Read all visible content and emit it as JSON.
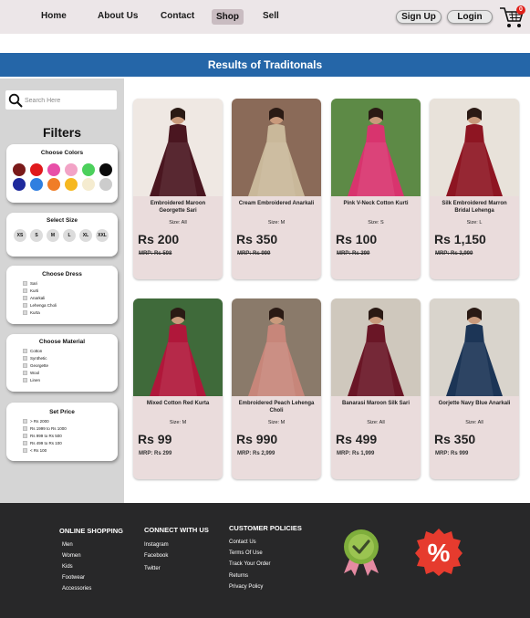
{
  "nav": {
    "home": "Home",
    "about": "About Us",
    "contact": "Contact",
    "shop": "Shop",
    "sell": "Sell",
    "signup": "Sign Up",
    "login": "Login",
    "cart_count": "0"
  },
  "results_title": "Results of Traditonals",
  "search": {
    "placeholder": "Search Here"
  },
  "filters": {
    "title": "Filters",
    "colors": {
      "title": "Choose Colors",
      "swatches": [
        "#7a1a1a",
        "#e0191c",
        "#e84fa8",
        "#f2a3c6",
        "#4cd05c",
        "#0b0b0b",
        "#1f2a9c",
        "#2f7fe0",
        "#f07d27",
        "#f6b820",
        "#f5ecd0",
        "#cccccc"
      ]
    },
    "size": {
      "title": "Select Size",
      "options": [
        "XS",
        "S",
        "M",
        "L",
        "XL",
        "XXL"
      ]
    },
    "dress": {
      "title": "Choose Dress",
      "options": [
        "Sari",
        "Kurti",
        "Anarkali",
        "Lehenga Choli",
        "Kurta"
      ]
    },
    "material": {
      "title": "Choose Material",
      "options": [
        "Cotton",
        "Synthetic",
        "Georgette",
        "Wool",
        "Linen"
      ]
    },
    "price": {
      "title": "Set Price",
      "options": [
        "> Rs 2000",
        "Rs 1999 to Rs 1000",
        "Rs 999 to Rs 500",
        "Rs 499 to Rs 100",
        "< Rs 100"
      ]
    }
  },
  "products": [
    {
      "name": "Embroidered Maroon Georgette Sari",
      "size": "Size: All",
      "price": "Rs 200",
      "mrp": "MRP: Rs 598",
      "mrp_strike": true,
      "garment_color": "#4a1620",
      "bg_color": "#efe8e3"
    },
    {
      "name": "Cream Embroidered Anarkali",
      "size": "Size: M",
      "price": "Rs 350",
      "mrp": "MRP: Rs 999",
      "mrp_strike": true,
      "garment_color": "#c9b89a",
      "bg_color": "#8a6a58"
    },
    {
      "name": "Pink V-Neck Cotton Kurti",
      "size": "Size: S",
      "price": "Rs 100",
      "mrp": "MRP: Rs 399",
      "mrp_strike": true,
      "garment_color": "#d8346e",
      "bg_color": "#5d8a46"
    },
    {
      "name": "Silk Embroidered Marron Bridal Lehenga",
      "size": "Size: L",
      "price": "Rs 1,150",
      "mrp": "MRP: Rs 3,999",
      "mrp_strike": true,
      "garment_color": "#8e1522",
      "bg_color": "#e8e2da"
    },
    {
      "name": "Mixed Cotton Red Kurta",
      "size": "Size: M",
      "price": "Rs 99",
      "mrp": "MRP: Rs 299",
      "mrp_strike": false,
      "garment_color": "#b0173a",
      "bg_color": "#3f6a3a"
    },
    {
      "name": "Embroidered Peach Lehenga Choli",
      "size": "Size: M",
      "price": "Rs 990",
      "mrp": "MRP: Rs 2,999",
      "mrp_strike": false,
      "garment_color": "#c7867a",
      "bg_color": "#8a7a6a"
    },
    {
      "name": "Banarasi Maroon Silk Sari",
      "size": "Size: All",
      "price": "Rs 499",
      "mrp": "MRP: Rs 1,999",
      "mrp_strike": false,
      "garment_color": "#6a1626",
      "bg_color": "#cfc8bd"
    },
    {
      "name": "Gorjette Navy Blue Anarkali",
      "size": "Size: All",
      "price": "Rs 350",
      "mrp": "MRP: Rs 999",
      "mrp_strike": false,
      "garment_color": "#1c3556",
      "bg_color": "#d9d4cc"
    }
  ],
  "footer": {
    "online_shopping": {
      "title": "ONLINE SHOPPING",
      "links": [
        "Men",
        "Women",
        "Kids",
        "Footwear",
        "Accessories"
      ]
    },
    "connect": {
      "title": "CONNECT WITH US",
      "links": [
        "Instagram",
        "Facebook",
        "Twitter"
      ]
    },
    "policies": {
      "title": "CUSTOMER POLICIES",
      "links": [
        "Contact Us",
        "Terms Of Use",
        "Track Your Order",
        "Returns",
        "Privacy Policy"
      ]
    },
    "discount_symbol": "%"
  }
}
